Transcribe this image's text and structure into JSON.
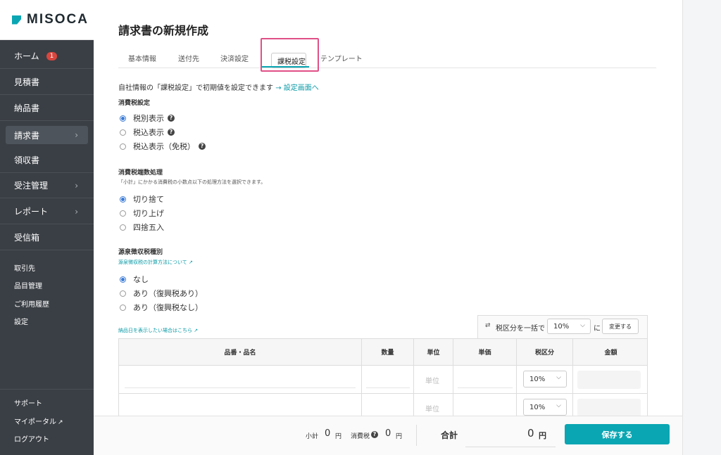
{
  "brand": {
    "name": "MISOCA"
  },
  "sidebar": {
    "items": [
      {
        "label": "ホーム",
        "badge": "1"
      },
      {
        "label": "見積書"
      },
      {
        "label": "納品書"
      },
      {
        "label": "請求書",
        "chevron": "›"
      },
      {
        "label": "領収書"
      },
      {
        "label": "受注管理",
        "chevron": "›"
      },
      {
        "label": "レポート",
        "chevron": "›"
      },
      {
        "label": "受信箱"
      }
    ],
    "sub_items": [
      "取引先",
      "品目管理",
      "ご利用履歴",
      "設定"
    ],
    "bottom_items": [
      "サポート",
      "マイポータル",
      "ログアウト"
    ]
  },
  "page": {
    "title": "請求書の新規作成"
  },
  "tabs": [
    "基本情報",
    "送付先",
    "決済設定",
    "課税設定",
    "テンプレート"
  ],
  "info": {
    "prefix": "自社情報の「課税設定」で初期値を設定できます",
    "link": "→ 設定画面へ"
  },
  "consumption_tax": {
    "heading": "消費税設定",
    "options": [
      "税別表示",
      "税込表示",
      "税込表示（免税）"
    ],
    "selected": 0
  },
  "rounding": {
    "heading": "消費税端数処理",
    "note": "「小計」にかかる消費税の小数点以下の処理方法を選択できます。",
    "options": [
      "切り捨て",
      "切り上げ",
      "四捨五入"
    ],
    "selected": 0
  },
  "withholding": {
    "heading": "源泉徴収税種別",
    "link": "源泉徴収税の計算方法について",
    "options": [
      "なし",
      "あり（復興税あり）",
      "あり（復興税なし）"
    ],
    "selected": 0
  },
  "delivery_link": "納品日を表示したい場合はこちら",
  "bulk_tax": {
    "label": "税区分を一括で",
    "value": "10%",
    "suffix": "に",
    "button": "変更する"
  },
  "table": {
    "headers": [
      "品番・品名",
      "数量",
      "単位",
      "単価",
      "税区分",
      "金額"
    ],
    "rows": [
      {
        "unit_placeholder": "単位",
        "tax": "10%"
      },
      {
        "unit_placeholder": "単位",
        "tax": "10%"
      }
    ]
  },
  "footer": {
    "subtotal_label": "小計",
    "subtotal_value": "0",
    "subtotal_unit": "円",
    "tax_label": "消費税",
    "tax_value": "0",
    "tax_unit": "円",
    "total_label": "合計",
    "total_value": "0",
    "total_unit": "円",
    "save": "保存する"
  },
  "colors": {
    "accent": "#0aa6b3",
    "sidebar": "#3a3f45",
    "badge": "#d9463e",
    "highlight": "#e04f86"
  },
  "icons": [
    "help-icon",
    "external-link-icon",
    "chevron-right-icon",
    "chevron-down-icon",
    "swap-icon"
  ]
}
